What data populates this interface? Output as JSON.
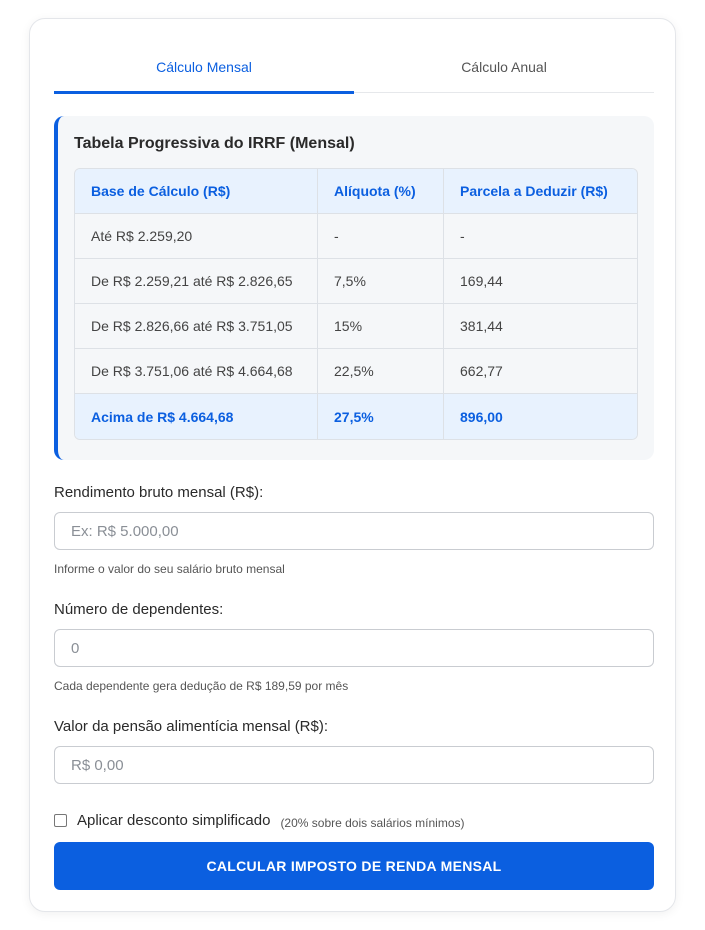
{
  "tabs": [
    {
      "label": "Cálculo Mensal",
      "active": true
    },
    {
      "label": "Cálculo Anual",
      "active": false
    }
  ],
  "irrf_table": {
    "title": "Tabela Progressiva do IRRF (Mensal)",
    "headers": [
      "Base de Cálculo (R$)",
      "Alíquota (%)",
      "Parcela a Deduzir (R$)"
    ],
    "rows": [
      [
        "Até R$ 2.259,20",
        "-",
        "-"
      ],
      [
        "De R$ 2.259,21 até R$ 2.826,65",
        "7,5%",
        "169,44"
      ],
      [
        "De R$ 2.826,66 até R$ 3.751,05",
        "15%",
        "381,44"
      ],
      [
        "De R$ 3.751,06 até R$ 4.664,68",
        "22,5%",
        "662,77"
      ],
      [
        "Acima de R$ 4.664,68",
        "27,5%",
        "896,00"
      ]
    ]
  },
  "form": {
    "income": {
      "label": "Rendimento bruto mensal (R$):",
      "placeholder": "Ex: R$ 5.000,00",
      "value": "",
      "hint": "Informe o valor do seu salário bruto mensal"
    },
    "dependents": {
      "label": "Número de dependentes:",
      "placeholder": "0",
      "value": "",
      "hint": "Cada dependente gera dedução de R$ 189,59 por mês"
    },
    "alimony": {
      "label": "Valor da pensão alimentícia mensal (R$):",
      "placeholder": "R$ 0,00",
      "value": ""
    },
    "simplified": {
      "label": "Aplicar desconto simplificado",
      "note": "(20% sobre dois salários mínimos)",
      "checked": false
    },
    "submit_label": "CALCULAR IMPOSTO DE RENDA MENSAL"
  },
  "colors": {
    "accent": "#0b5fe0",
    "highlight_bg": "#e8f2fe"
  }
}
